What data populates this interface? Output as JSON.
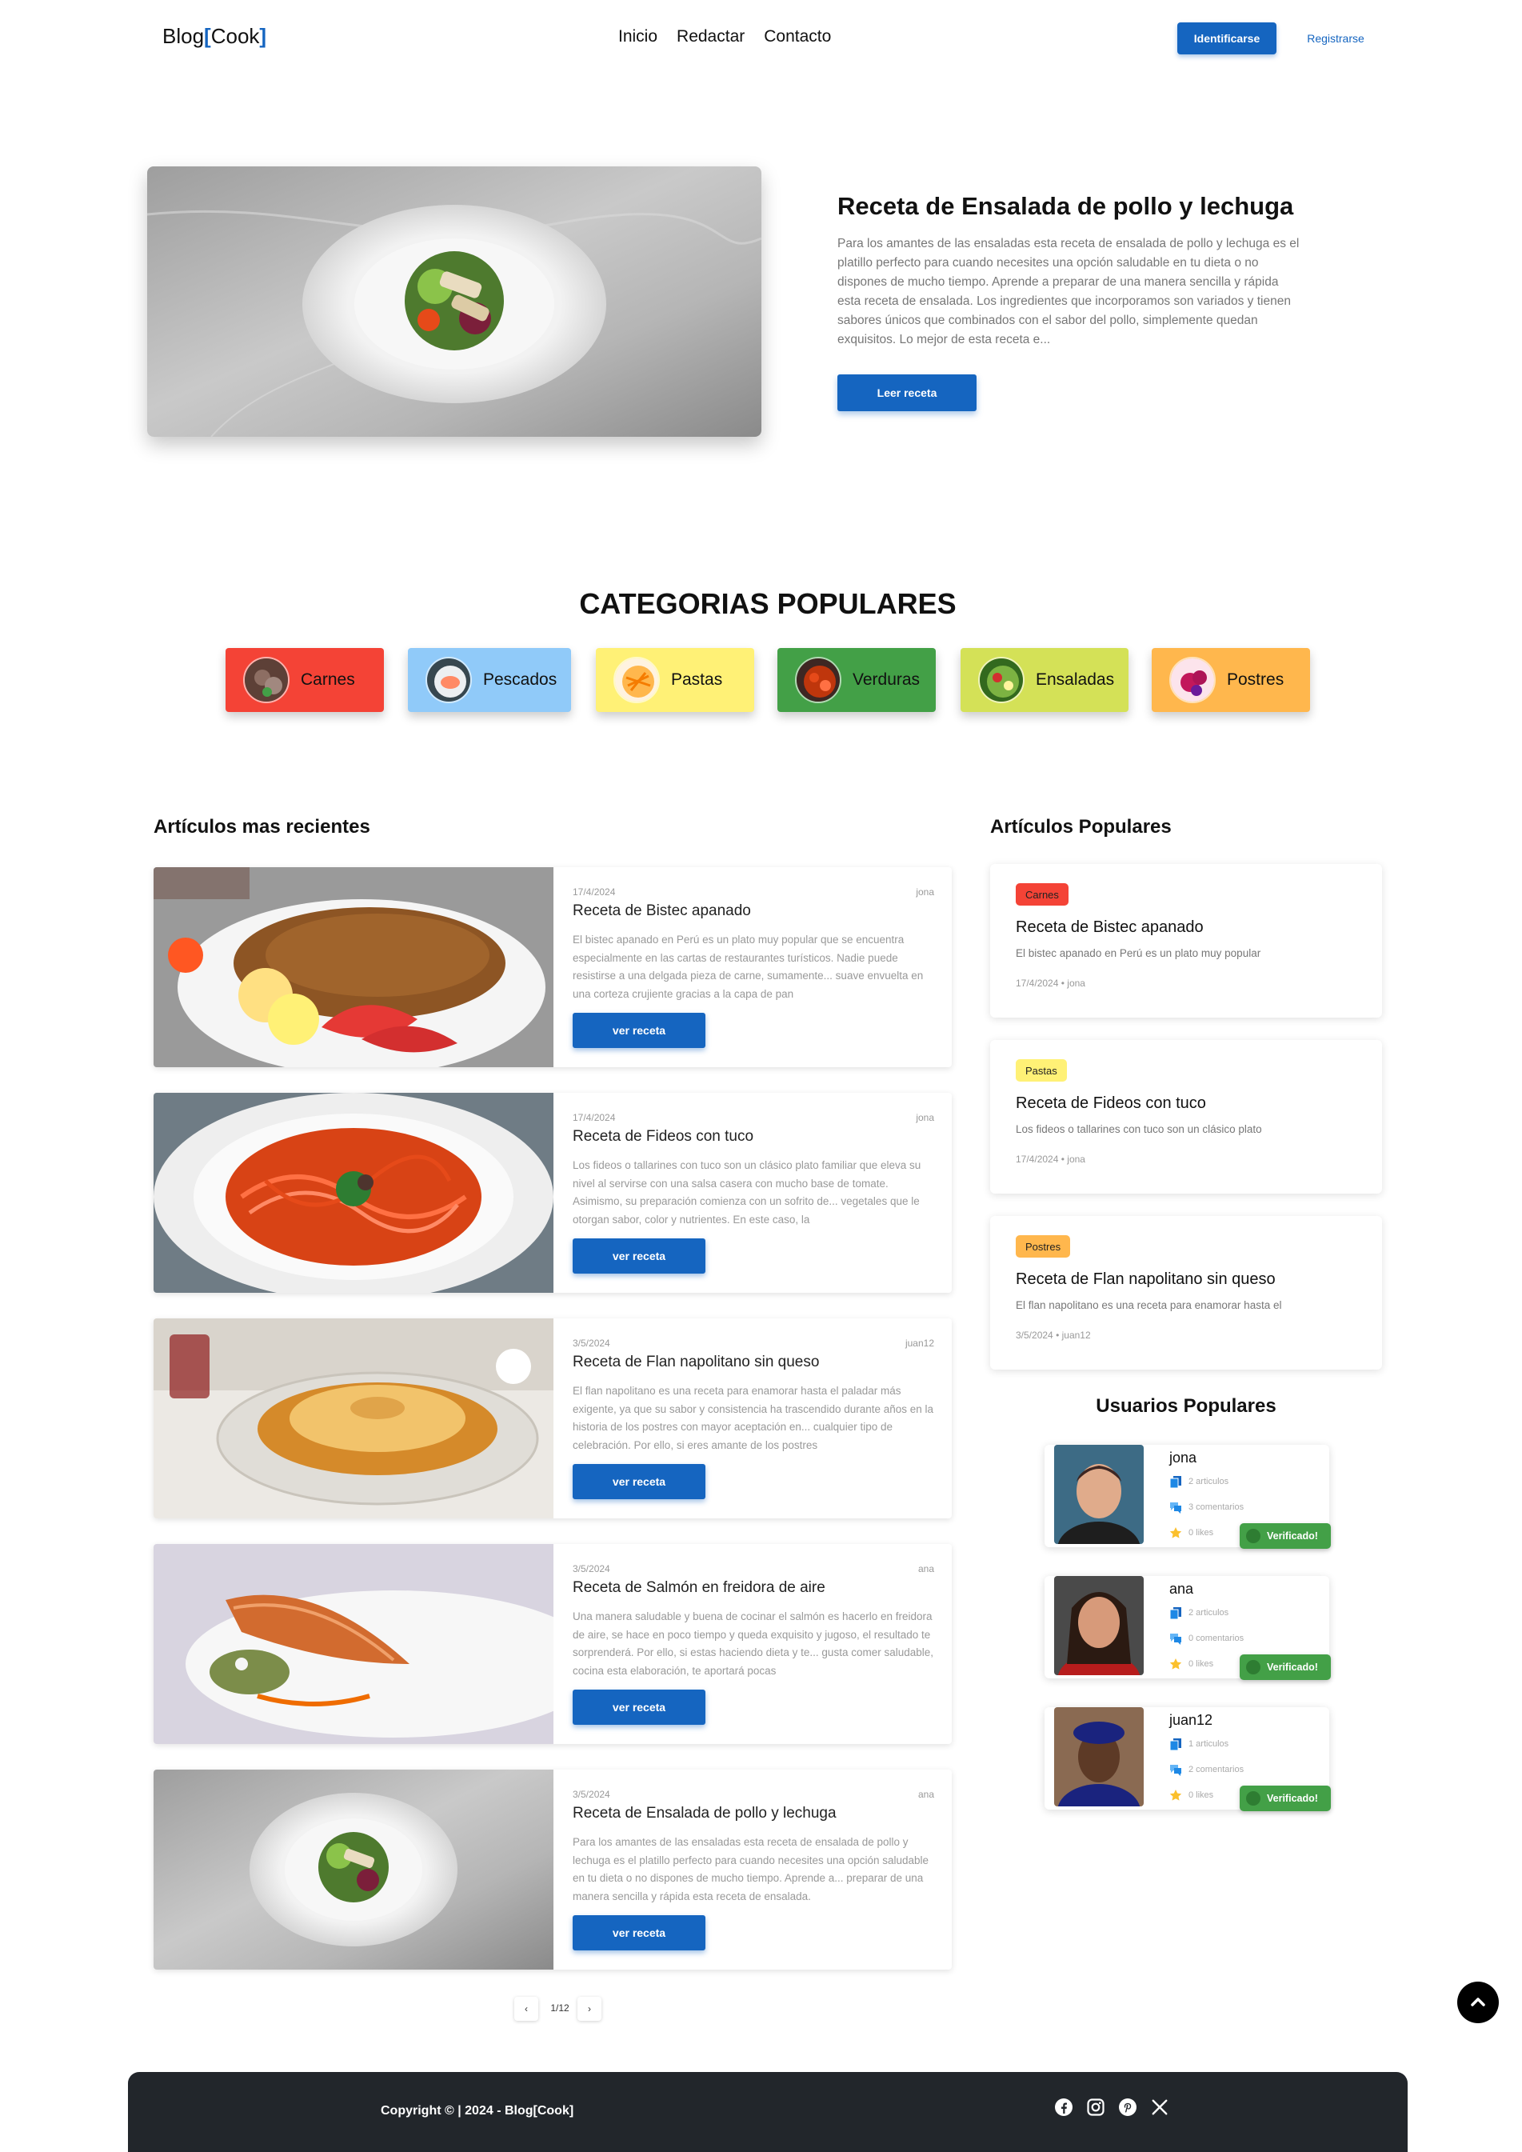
{
  "nav": {
    "brand_text": "Blog",
    "brand_bracket_open": "[",
    "brand_accent": "Cook",
    "brand_bracket_close": "]",
    "links": [
      "Inicio",
      "Redactar",
      "Contacto"
    ],
    "login_label": "Identificarse",
    "register_label": "Registrarse"
  },
  "hero": {
    "title": "Receta de Ensalada de pollo y lechuga",
    "text": "Para los amantes de las ensaladas esta receta de ensalada de pollo y lechuga es el platillo perfecto para cuando necesites una opción saludable en tu dieta o no dispones de mucho tiempo. Aprende a preparar de una manera sencilla y rápida esta receta de ensalada. Los ingredientes que incorporamos son variados y tienen sabores únicos que combinados con el sabor del pollo, simplemente quedan exquisitos. Lo mejor de esta receta e...",
    "button_label": "Leer receta"
  },
  "categories": {
    "title": "CATEGORIAS POPULARES",
    "items": [
      {
        "label": "Carnes",
        "color": "#f44336"
      },
      {
        "label": "Pescados",
        "color": "#90caf9"
      },
      {
        "label": "Pastas",
        "color": "#fff176"
      },
      {
        "label": "Verduras",
        "color": "#43a047"
      },
      {
        "label": "Ensaladas",
        "color": "#d4e157"
      },
      {
        "label": "Postres",
        "color": "#ffb74d"
      }
    ]
  },
  "recent": {
    "title": "Artículos mas recientes",
    "articles": [
      {
        "date": "17/4/2024",
        "author": "jona",
        "title": "Receta de Bistec apanado",
        "text": "El bistec apanado en Perú es un plato muy popular que se encuentra especialmente en las cartas de restaurantes turísticos. Nadie puede resistirse a una delgada pieza de carne, sumamente... suave envuelta en una corteza crujiente gracias a la capa de pan",
        "button": "ver receta"
      },
      {
        "date": "17/4/2024",
        "author": "jona",
        "title": "Receta de Fideos con tuco",
        "text": "Los fideos o tallarines con tuco son un clásico plato familiar que eleva su nivel al servirse con una salsa casera con mucho base de tomate. Asimismo, su preparación comienza con un sofrito de... vegetales que le otorgan sabor, color y nutrientes. En este caso, la",
        "button": "ver receta"
      },
      {
        "date": "3/5/2024",
        "author": "juan12",
        "title": "Receta de Flan napolitano sin queso",
        "text": "El flan napolitano es una receta para enamorar hasta el paladar más exigente, ya que su sabor y consistencia ha trascendido durante años en la historia de los postres con mayor aceptación en... cualquier tipo de celebración. Por ello, si eres amante de los postres",
        "button": "ver receta"
      },
      {
        "date": "3/5/2024",
        "author": "ana",
        "title": "Receta de Salmón en freidora de aire",
        "text": "Una manera saludable y buena de cocinar el salmón es hacerlo en freidora de aire, se hace en poco tiempo y queda exquisito y jugoso, el resultado te sorprenderá. Por ello, si estas haciendo dieta y te... gusta comer saludable, cocina esta elaboración, te aportará pocas",
        "button": "ver receta"
      },
      {
        "date": "3/5/2024",
        "author": "ana",
        "title": "Receta de Ensalada de pollo y lechuga",
        "text": "Para los amantes de las ensaladas esta receta de ensalada de pollo y lechuga es el platillo perfecto para cuando necesites una opción saludable en tu dieta o no dispones de mucho tiempo. Aprende a... preparar de una manera sencilla y rápida esta receta de ensalada.",
        "button": "ver receta"
      }
    ],
    "pagination": {
      "prev": "‹",
      "label": "1/12",
      "next": "›"
    }
  },
  "popular": {
    "title": "Artículos Populares",
    "articles": [
      {
        "category": "Carnes",
        "category_color": "#f44336",
        "title": "Receta de Bistec apanado",
        "text": "El bistec apanado en Perú es un plato muy popular",
        "date": "17/4/2024",
        "separator": "•",
        "author": "jona"
      },
      {
        "category": "Pastas",
        "category_color": "#fff176",
        "title": "Receta de Fideos con tuco",
        "text": "Los fideos o tallarines con tuco son un clásico plato",
        "date": "17/4/2024",
        "separator": "•",
        "author": "jona"
      },
      {
        "category": "Postres",
        "category_color": "#ffb74d",
        "title": "Receta de Flan napolitano sin queso",
        "text": "El flan napolitano es una receta para enamorar hasta el",
        "date": "3/5/2024",
        "separator": "•",
        "author": "juan12"
      }
    ]
  },
  "users": {
    "title": "Usuarios Populares",
    "items": [
      {
        "name": "jona",
        "articles": "2 articulos",
        "comments": "3 comentarios",
        "likes": "0 likes",
        "badge": "Verificado!"
      },
      {
        "name": "ana",
        "articles": "2 articulos",
        "comments": "0 comentarios",
        "likes": "0 likes",
        "badge": "Verificado!"
      },
      {
        "name": "juan12",
        "articles": "1 articulos",
        "comments": "2 comentarios",
        "likes": "0 likes",
        "badge": "Verificado!"
      }
    ]
  },
  "footer": {
    "copyright": "Copyright © | 2024 - Blog[Cook]",
    "social_icons": [
      "facebook-icon",
      "instagram-icon",
      "pinterest-icon",
      "x-icon"
    ]
  },
  "colors": {
    "primary": "#1565c0",
    "verified": "#43a047",
    "footer_bg": "#22262b"
  }
}
